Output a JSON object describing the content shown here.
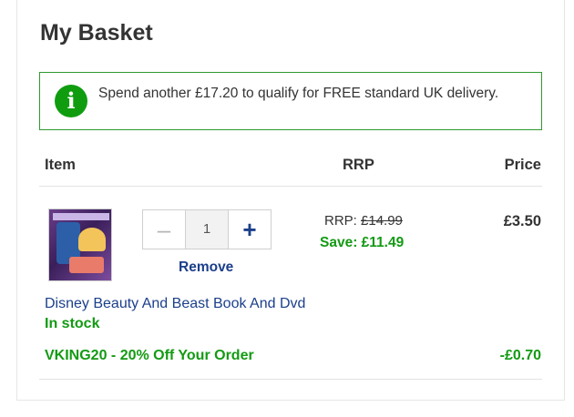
{
  "basket": {
    "title": "My Basket"
  },
  "notice": {
    "icon": "info-icon",
    "message": "Spend another £17.20 to qualify for FREE standard UK delivery."
  },
  "table": {
    "headers": {
      "item": "Item",
      "rrp": "RRP",
      "price": "Price"
    }
  },
  "product": {
    "name": "Disney Beauty And Beast Book And Dvd",
    "stock": "In stock",
    "quantity": "1",
    "remove_label": "Remove",
    "rrp_label": "RRP:",
    "rrp_value": "£14.99",
    "save_text": "Save: £11.49",
    "price": "£3.50"
  },
  "promo": {
    "label": "VKING20 - 20% Off Your Order",
    "amount": "-£0.70"
  },
  "colors": {
    "accent_green": "#139a13",
    "link_blue": "#1b3f8b",
    "notice_border": "#2e9a2e"
  }
}
